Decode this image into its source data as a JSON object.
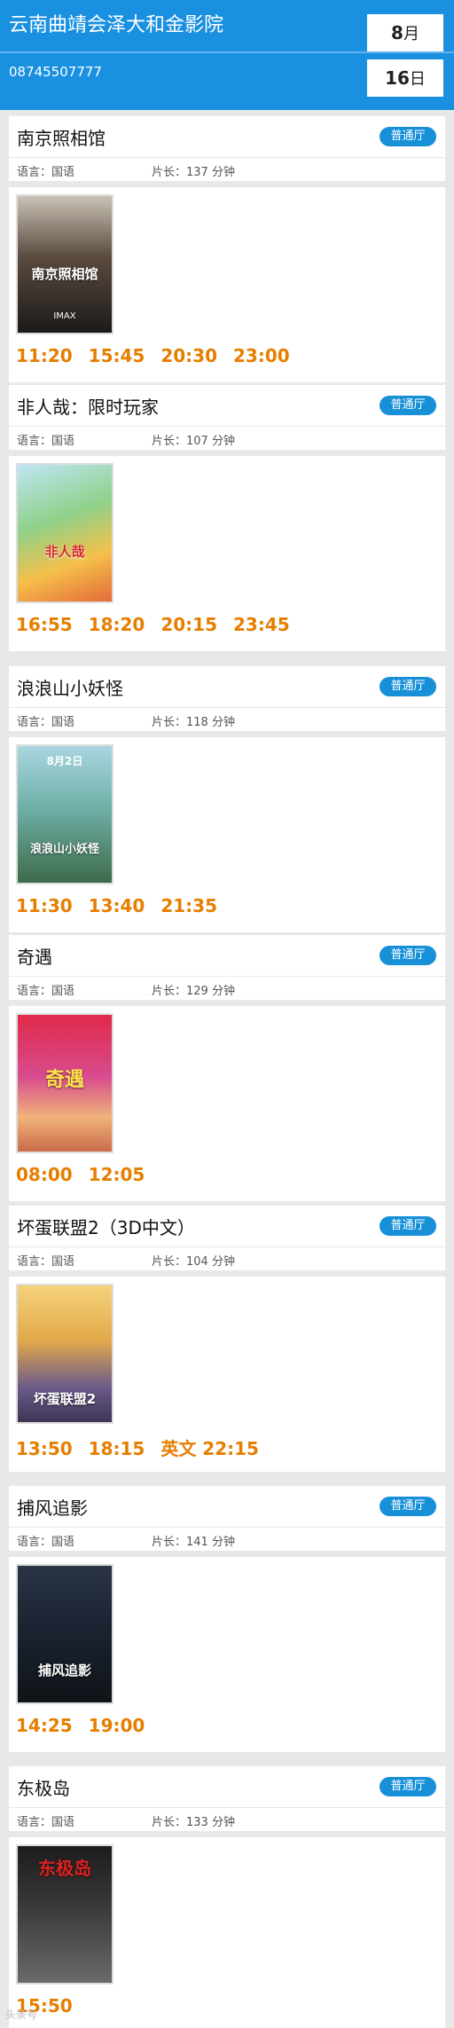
{
  "header": {
    "cinema_name": "云南曲靖会泽大和金影院",
    "phone": "08745507777",
    "month_num": "8",
    "month_unit": "月",
    "day_num": "16",
    "day_unit": "日"
  },
  "labels": {
    "language_prefix": "语言：",
    "duration_prefix": "片长：",
    "duration_unit": " 分钟"
  },
  "movies": [
    {
      "title": "南京照相馆",
      "hall": "普通厅",
      "language": "国语",
      "duration": "137",
      "poster_text": "南京照相馆",
      "poster_sub": "IMAX",
      "times": [
        "11:20",
        "15:45",
        "20:30",
        "23:00"
      ]
    },
    {
      "title": "非人哉：限时玩家",
      "hall": "普通厅",
      "language": "国语",
      "duration": "107",
      "poster_text": "非人哉",
      "poster_sub": "",
      "times": [
        "16:55",
        "18:20",
        "20:15",
        "23:45"
      ]
    },
    {
      "title": "浪浪山小妖怪",
      "hall": "普通厅",
      "language": "国语",
      "duration": "118",
      "poster_text": "浪浪山小妖怪",
      "poster_sub": "8月2日",
      "times": [
        "11:30",
        "13:40",
        "21:35"
      ]
    },
    {
      "title": "奇遇",
      "hall": "普通厅",
      "language": "国语",
      "duration": "129",
      "poster_text": "奇遇",
      "poster_sub": "",
      "times": [
        "08:00",
        "12:05"
      ]
    },
    {
      "title": "坏蛋联盟2（3D中文）",
      "hall": "普通厅",
      "language": "国语",
      "duration": "104",
      "poster_text": "坏蛋联盟2",
      "poster_sub": "",
      "times": [
        "13:50",
        "18:15",
        "英文 22:15"
      ]
    },
    {
      "title": "捕风追影",
      "hall": "普通厅",
      "language": "国语",
      "duration": "141",
      "poster_text": "捕风追影",
      "poster_sub": "",
      "times": [
        "14:25",
        "19:00"
      ]
    },
    {
      "title": "东极岛",
      "hall": "普通厅",
      "language": "国语",
      "duration": "133",
      "poster_text": "东极岛",
      "poster_sub": "",
      "times": [
        "15:50"
      ]
    }
  ],
  "colors": {
    "header_bg": "#1a90e0",
    "hall_badge": "#1790d8",
    "showtime": "#e67e00"
  },
  "watermark": "头条号"
}
